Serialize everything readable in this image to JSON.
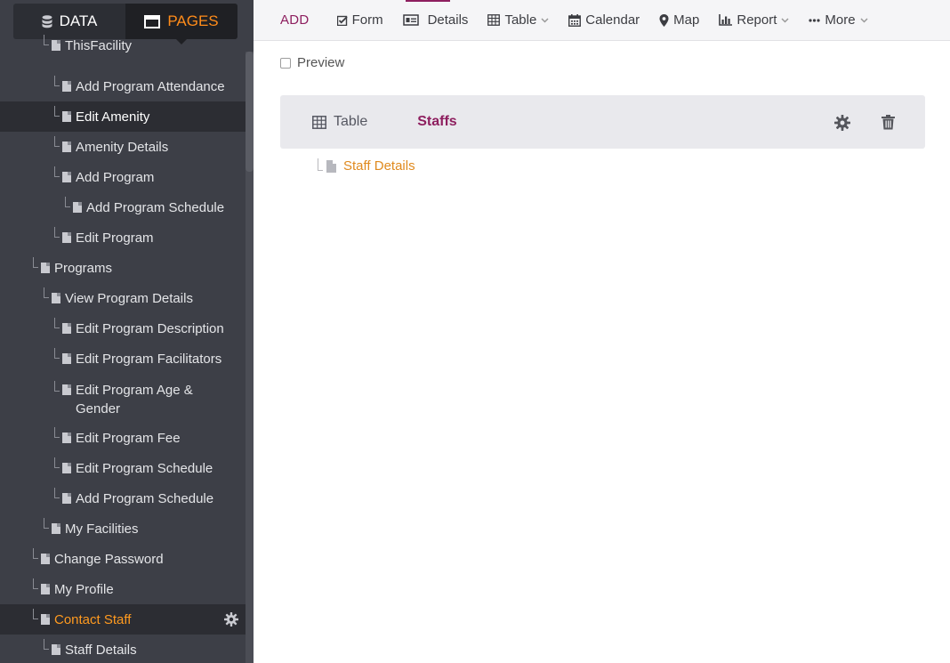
{
  "sidebar": {
    "tabs": [
      {
        "label": "DATA",
        "icon": "database-icon",
        "active": false
      },
      {
        "label": "PAGES",
        "icon": "window-icon",
        "active": true
      }
    ],
    "items": [
      {
        "label": "ThisFacility",
        "level": 2,
        "state": ""
      },
      {
        "label": "Add Program Attendance",
        "level": 3,
        "state": ""
      },
      {
        "label": "Edit Amenity",
        "level": 3,
        "state": "selected"
      },
      {
        "label": "Amenity Details",
        "level": 3,
        "state": ""
      },
      {
        "label": "Add Program",
        "level": 3,
        "state": ""
      },
      {
        "label": "Add Program Schedule",
        "level": 4,
        "state": ""
      },
      {
        "label": "Edit Program",
        "level": 3,
        "state": ""
      },
      {
        "label": "Programs",
        "level": 1,
        "state": ""
      },
      {
        "label": "View Program Details",
        "level": 2,
        "state": ""
      },
      {
        "label": "Edit Program Description",
        "level": 3,
        "state": ""
      },
      {
        "label": "Edit Program Facilitators",
        "level": 3,
        "state": ""
      },
      {
        "label": "Edit Program Age & Gender",
        "level": 3,
        "state": ""
      },
      {
        "label": "Edit Program Fee",
        "level": 3,
        "state": ""
      },
      {
        "label": "Edit Program Schedule",
        "level": 3,
        "state": ""
      },
      {
        "label": "Add Program Schedule",
        "level": 3,
        "state": ""
      },
      {
        "label": "My Facilities",
        "level": 2,
        "state": ""
      },
      {
        "label": "Change Password",
        "level": 1,
        "state": ""
      },
      {
        "label": "My Profile",
        "level": 1,
        "state": ""
      },
      {
        "label": "Contact Staff",
        "level": 1,
        "state": "active"
      },
      {
        "label": "Staff Details",
        "level": 2,
        "state": ""
      }
    ]
  },
  "toolbar": {
    "add_label": "ADD",
    "items": [
      {
        "label": "Form",
        "icon": "form-check-icon",
        "dropdown": false
      },
      {
        "label": "Details",
        "icon": "details-card-icon",
        "dropdown": false
      },
      {
        "label": "Table",
        "icon": "table-grid-icon",
        "dropdown": true
      },
      {
        "label": "Calendar",
        "icon": "calendar-icon",
        "dropdown": false
      },
      {
        "label": "Map",
        "icon": "map-marker-icon",
        "dropdown": false
      },
      {
        "label": "Report",
        "icon": "bar-chart-icon",
        "dropdown": true
      },
      {
        "label": "More",
        "icon": "ellipsis-icon",
        "dropdown": true
      }
    ]
  },
  "main": {
    "preview_label": "Preview",
    "view": {
      "type_label": "Table",
      "name": "Staffs"
    },
    "child_page": "Staff Details"
  },
  "colors": {
    "accent": "#8e1f5f",
    "orange": "#ff8c1a",
    "sidebar_bg": "#3d3f47"
  }
}
